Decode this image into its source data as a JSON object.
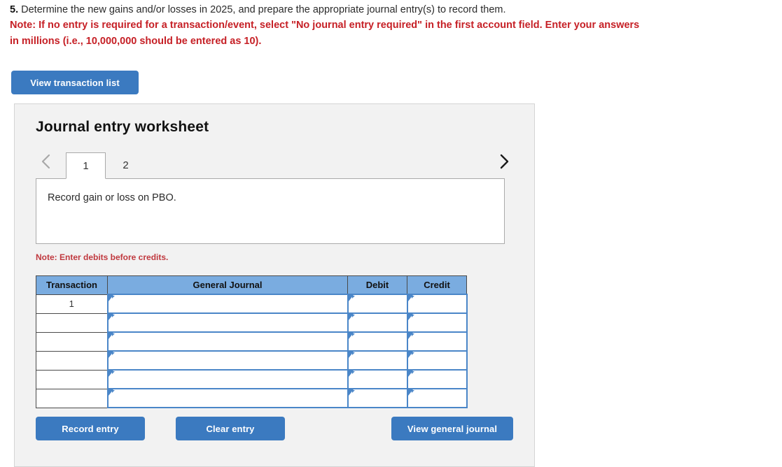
{
  "question": {
    "number": "5.",
    "text": "Determine the new gains and/or losses in 2025, and prepare the appropriate journal entry(s) to record them.",
    "note_line_1": "Note: If no entry is required for a transaction/event, select \"No journal entry required\" in the first account field. Enter your answers",
    "note_line_2": "in millions (i.e., 10,000,000 should be entered as 10)."
  },
  "toolbar": {
    "view_transaction_list_label": "View transaction list"
  },
  "worksheet": {
    "title": "Journal entry worksheet",
    "tabs": [
      {
        "label": "1",
        "active": true
      },
      {
        "label": "2",
        "active": false
      }
    ],
    "prev_arrow_icon": "chevron-left-icon",
    "next_arrow_icon": "chevron-right-icon",
    "description": "Record gain or loss on PBO.",
    "note_debits": "Note: Enter debits before credits.",
    "table": {
      "headers": [
        "Transaction",
        "General Journal",
        "Debit",
        "Credit"
      ],
      "rows": [
        {
          "transaction": "1",
          "general_journal": "",
          "debit": "",
          "credit": ""
        },
        {
          "transaction": "",
          "general_journal": "",
          "debit": "",
          "credit": ""
        },
        {
          "transaction": "",
          "general_journal": "",
          "debit": "",
          "credit": ""
        },
        {
          "transaction": "",
          "general_journal": "",
          "debit": "",
          "credit": ""
        },
        {
          "transaction": "",
          "general_journal": "",
          "debit": "",
          "credit": ""
        },
        {
          "transaction": "",
          "general_journal": "",
          "debit": "",
          "credit": ""
        }
      ]
    },
    "buttons": {
      "record_entry": "Record entry",
      "clear_entry": "Clear entry",
      "view_general_journal": "View general journal"
    }
  },
  "colors": {
    "button_blue": "#3b7ac0",
    "header_blue": "#7aace0",
    "cell_border_blue": "#4a86c8",
    "note_red": "#c62026",
    "panel_gray": "#f2f2f2"
  }
}
